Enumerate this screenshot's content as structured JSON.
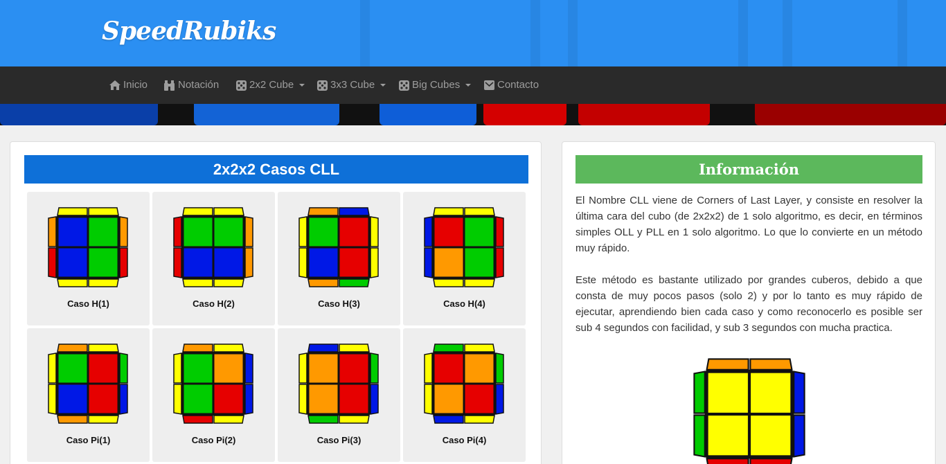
{
  "brand": {
    "name": "SpeedRubiks"
  },
  "nav": {
    "items": [
      {
        "label": "Inicio",
        "icon": "home-icon"
      },
      {
        "label": "Notación",
        "icon": "binoculars-icon"
      },
      {
        "label": "2x2 Cube",
        "icon": "dice-icon",
        "dropdown": true
      },
      {
        "label": "3x3 Cube",
        "icon": "dice-icon",
        "dropdown": true
      },
      {
        "label": "Big Cubes",
        "icon": "dice-icon",
        "dropdown": true
      },
      {
        "label": "Contacto",
        "icon": "envelope-icon"
      }
    ]
  },
  "colors": {
    "header": "#2b8ff2",
    "navbar": "#2a2a2a",
    "title_blue": "#0e70d8",
    "title_green": "#5cb85c",
    "sticker_yellow": "#ffff00",
    "sticker_red": "#e60000",
    "sticker_blue": "#0018e6",
    "sticker_green": "#00cc00",
    "sticker_orange": "#ff9900"
  },
  "cases_panel": {
    "title": "2x2x2 Casos CLL",
    "cases": [
      {
        "caption": "Caso H(1)",
        "face": [
          "blue",
          "green",
          "blue",
          "green"
        ],
        "top": [
          "yellow",
          "yellow"
        ],
        "bottom": [
          "yellow",
          "yellow"
        ],
        "left": [
          "orange",
          "red"
        ],
        "right": [
          "orange",
          "red"
        ]
      },
      {
        "caption": "Caso H(2)",
        "face": [
          "green",
          "green",
          "blue",
          "blue"
        ],
        "top": [
          "yellow",
          "yellow"
        ],
        "bottom": [
          "yellow",
          "yellow"
        ],
        "left": [
          "red",
          "red"
        ],
        "right": [
          "orange",
          "orange"
        ]
      },
      {
        "caption": "Caso H(3)",
        "face": [
          "green",
          "red",
          "blue",
          "red"
        ],
        "top": [
          "orange",
          "blue"
        ],
        "bottom": [
          "orange",
          "green"
        ],
        "left": [
          "yellow",
          "yellow"
        ],
        "right": [
          "yellow",
          "yellow"
        ]
      },
      {
        "caption": "Caso H(4)",
        "face": [
          "red",
          "green",
          "orange",
          "green"
        ],
        "top": [
          "yellow",
          "yellow"
        ],
        "bottom": [
          "yellow",
          "yellow"
        ],
        "left": [
          "blue",
          "blue"
        ],
        "right": [
          "red",
          "red"
        ]
      },
      {
        "caption": "Caso Pi(1)",
        "face": [
          "green",
          "red",
          "blue",
          "red"
        ],
        "top": [
          "orange",
          "yellow"
        ],
        "bottom": [
          "orange",
          "yellow"
        ],
        "left": [
          "yellow",
          "yellow"
        ],
        "right": [
          "green",
          "blue"
        ]
      },
      {
        "caption": "Caso Pi(2)",
        "face": [
          "green",
          "orange",
          "green",
          "red"
        ],
        "top": [
          "orange",
          "yellow"
        ],
        "bottom": [
          "red",
          "yellow"
        ],
        "left": [
          "yellow",
          "yellow"
        ],
        "right": [
          "blue",
          "blue"
        ]
      },
      {
        "caption": "Caso Pi(3)",
        "face": [
          "orange",
          "red",
          "orange",
          "red"
        ],
        "top": [
          "blue",
          "yellow"
        ],
        "bottom": [
          "green",
          "yellow"
        ],
        "left": [
          "yellow",
          "yellow"
        ],
        "right": [
          "green",
          "blue"
        ]
      },
      {
        "caption": "Caso Pi(4)",
        "face": [
          "red",
          "orange",
          "orange",
          "red"
        ],
        "top": [
          "green",
          "yellow"
        ],
        "bottom": [
          "blue",
          "yellow"
        ],
        "left": [
          "yellow",
          "yellow"
        ],
        "right": [
          "green",
          "blue"
        ]
      }
    ]
  },
  "info_panel": {
    "title": "Información",
    "paragraph1": "El Nombre CLL viene de Corners of Last Layer, y consiste en resolver la última cara del cubo (de 2x2x2) de 1 solo algoritmo, es decir, en términos simples OLL y PLL en 1 solo algoritmo. Lo que lo convierte en un método muy rápido.",
    "paragraph2": "Este método es bastante utilizado por grandes cuberos, debido a que consta de muy pocos pasos (solo 2) y por lo tanto es muy rápido de ejecutar, aprendiendo bien cada caso y como reconocerlo es posible ser sub 4 segundos con facilidad, y sub 3 segundos con mucha practica.",
    "solved_cube": {
      "face": [
        "yellow",
        "yellow",
        "yellow",
        "yellow"
      ],
      "top": [
        "orange",
        "orange"
      ],
      "bottom": [
        "red",
        "red"
      ],
      "left": [
        "green",
        "green"
      ],
      "right": [
        "blue",
        "blue"
      ]
    }
  }
}
